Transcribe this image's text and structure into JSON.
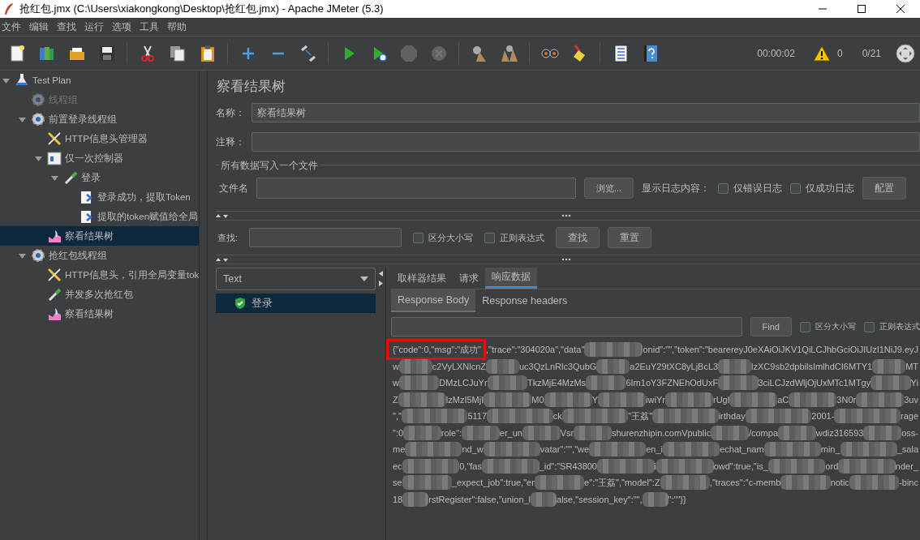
{
  "window": {
    "title": "抢红包.jmx (C:\\Users\\xiakongkong\\Desktop\\抢红包.jmx) - Apache JMeter (5.3)"
  },
  "menu": [
    "文件",
    "编辑",
    "查找",
    "运行",
    "选项",
    "工具",
    "帮助"
  ],
  "toolbar": {
    "buttons": [
      {
        "disabled": false
      },
      {
        "disabled": false
      },
      {
        "disabled": false
      },
      {
        "disabled": false
      },
      {
        "disabled": false
      },
      {
        "disabled": false
      },
      {
        "disabled": false
      },
      {
        "disabled": false
      },
      {
        "disabled": false
      },
      {
        "disabled": false
      },
      {
        "disabled": false
      },
      {
        "disabled": false
      },
      {
        "disabled": true
      },
      {
        "disabled": true
      },
      {
        "disabled": false
      },
      {
        "disabled": false
      },
      {
        "disabled": false
      },
      {
        "disabled": false
      },
      {
        "disabled": false
      },
      {
        "disabled": false
      }
    ],
    "elapsed": "00:00:02",
    "warnings": "0",
    "threads": "0/21"
  },
  "tree": [
    {
      "label": "Test Plan",
      "kind": "plan",
      "expanded": true,
      "selected": false,
      "disabled": false,
      "children": [
        {
          "label": "线程组",
          "kind": "group",
          "expanded": false,
          "selected": false,
          "disabled": true
        },
        {
          "label": "前置登录线程组",
          "kind": "group",
          "expanded": true,
          "selected": false,
          "disabled": false,
          "children": [
            {
              "label": "HTTP信息头管理器",
              "kind": "config",
              "expanded": false,
              "selected": false,
              "disabled": false
            },
            {
              "label": "仅一次控制器",
              "kind": "controller",
              "expanded": true,
              "selected": false,
              "disabled": false,
              "children": [
                {
                  "label": "登录",
                  "kind": "sampler",
                  "expanded": true,
                  "selected": false,
                  "disabled": false,
                  "children": [
                    {
                      "label": "登录成功，提取Token",
                      "kind": "extractor",
                      "expanded": false,
                      "selected": false,
                      "disabled": false
                    },
                    {
                      "label": "提取的token赋值给全局",
                      "kind": "extractor",
                      "expanded": false,
                      "selected": false,
                      "disabled": false
                    }
                  ]
                }
              ]
            },
            {
              "label": "察看结果树",
              "kind": "listener",
              "expanded": false,
              "selected": true,
              "disabled": false
            }
          ]
        },
        {
          "label": "抢红包线程组",
          "kind": "group",
          "expanded": true,
          "selected": false,
          "disabled": false,
          "children": [
            {
              "label": "HTTP信息头，引用全局变量tok",
              "kind": "config",
              "expanded": false,
              "selected": false,
              "disabled": false
            },
            {
              "label": "并发多次抢红包",
              "kind": "sampler",
              "expanded": false,
              "selected": false,
              "disabled": false
            },
            {
              "label": "察看结果树",
              "kind": "listener",
              "expanded": false,
              "selected": false,
              "disabled": false
            }
          ]
        }
      ]
    }
  ],
  "panel": {
    "title": "察看结果树",
    "name_label": "名称：",
    "name_value": "察看结果树",
    "comment_label": "注释：",
    "file_group": "所有数据写入一个文件",
    "file_label": "文件名",
    "browse": "浏览...",
    "log_label": "显示日志内容：",
    "log_options": [
      {
        "label": "仅错误日志",
        "checked": false
      },
      {
        "label": "仅成功日志",
        "checked": false
      }
    ],
    "configure": "配置",
    "search_label": "查找:",
    "search_options": [
      {
        "label": "区分大小写",
        "checked": false
      },
      {
        "label": "正则表达式",
        "checked": false
      }
    ],
    "search_button": "查找",
    "reset_button": "重置"
  },
  "results": {
    "renderer": "Text",
    "samples": [
      {
        "label": "登录",
        "success": true,
        "selected": true
      }
    ],
    "tabs": [
      {
        "label": "取样器结果",
        "selected": false
      },
      {
        "label": "请求",
        "selected": false
      },
      {
        "label": "响应数据",
        "selected": true
      }
    ],
    "subtabs": [
      {
        "label": "Response Body",
        "selected": true
      },
      {
        "label": "Response headers",
        "selected": false
      }
    ],
    "find_button": "Find",
    "highlight": "{\"code\":0,\"msg\":\"成功\"",
    "find_options": [
      {
        "label": "区分大小写",
        "checked": false
      },
      {
        "label": "正则表达式",
        "checked": false
      }
    ],
    "body_lines": [
      [
        ",\"trace\":\"304020a\",\"data\"",
        "onid\":\"\",\"token\":\"bearereyJ0eXAiOiJKV1QiLCJhbGciOiJIUzI1NiJ9.eyJ"
      ],
      [
        "w",
        "c2VyLXNlcnZ",
        "uc3QzLnRlc3QubG",
        "a2EuY29tXC8yLjBcL3",
        "lzXC9sb2dpbilsImlhdCI6MTY1",
        "MT"
      ],
      [
        "w",
        "DMzLCJuYr",
        "TkzMjE4MzMs",
        "6Im1oY3FZNEhOdUxF",
        "3ciLCJzdWljOjUxMTc1MTgy",
        "Yi"
      ],
      [
        "Z",
        "lzMzI5MjI",
        "M0",
        "Y",
        "iwiYr",
        "rUgl",
        "aC",
        "3N0r",
        "3uv"
      ],
      [
        "\",\"",
        "5117",
        "ck",
        "\"王荔\"",
        "irthday",
        "2001-",
        "rage"
      ],
      [
        "\":0",
        "role\":",
        "er_un",
        "Vsr",
        "shurenzhipin.comVpublic",
        "/compa",
        "wdiz316593",
        "oss-"
      ],
      [
        "me",
        "nd_w",
        "vatar\":\"\",\"we",
        "en_i",
        "echat_nam",
        "min_",
        "_sala"
      ],
      [
        "ec",
        "0,\"fas",
        "_id\":\"SR43800",
        "i",
        "owd\":true,\"is_",
        "ord",
        "nder_"
      ],
      [
        "se",
        "_expect_job\":true,\"er",
        "e\":\"王荔\",\"model\":Z",
        ",\"traces\":\"c-memb",
        "notic",
        "-binc"
      ],
      [
        "18",
        "rstRegister\":false,\"union_l",
        "alse,\"session_key\":\"\",",
        "\":\"\"}}"
      ]
    ]
  }
}
